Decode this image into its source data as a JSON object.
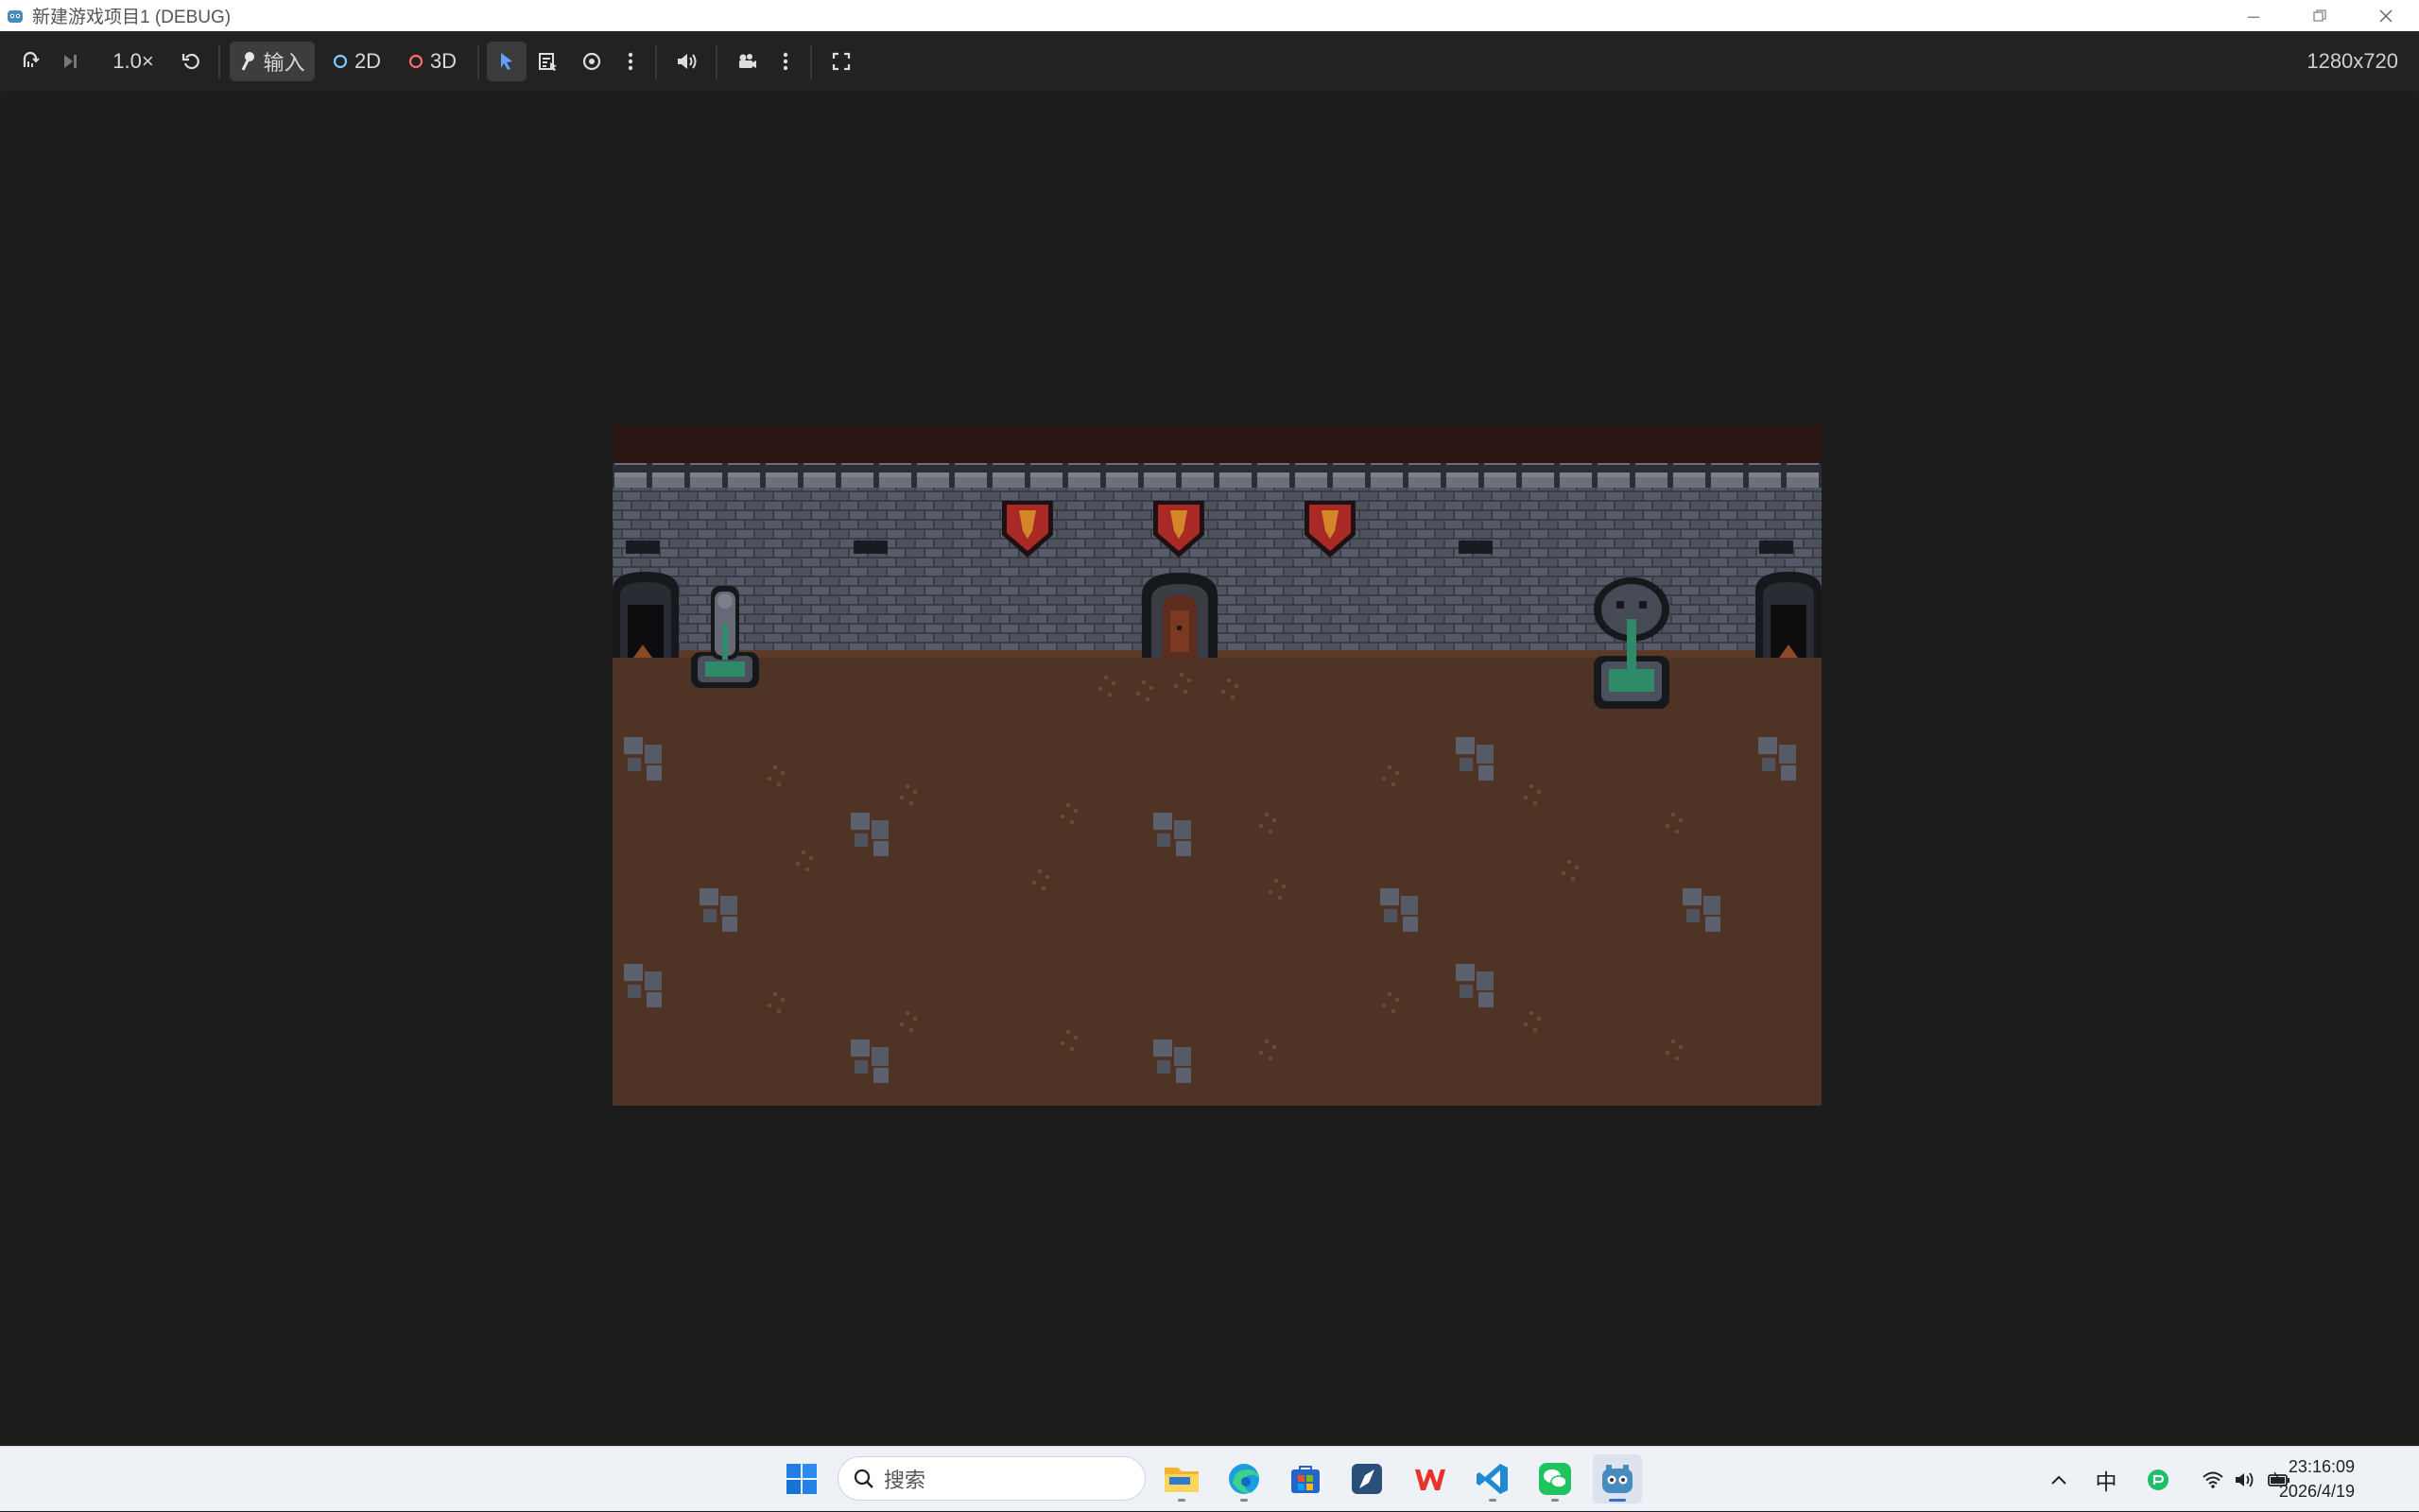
{
  "window": {
    "title": "新建游戏项目1 (DEBUG)",
    "app_icon": "godot-icon"
  },
  "toolbar": {
    "speed_label": "1.0×",
    "input_label": "输入",
    "mode_2d_label": "2D",
    "mode_3d_label": "3D",
    "resolution": "1280x720"
  },
  "taskbar": {
    "search_placeholder": "搜索",
    "ime_label": "中",
    "time": "23:16:09",
    "date": "2026/4/19"
  },
  "colors": {
    "accent": "#5fa3ff",
    "mode_2d": "#7ec9ff",
    "mode_3d": "#ff6d6d",
    "taskbar_active": "#2f6fd6"
  }
}
